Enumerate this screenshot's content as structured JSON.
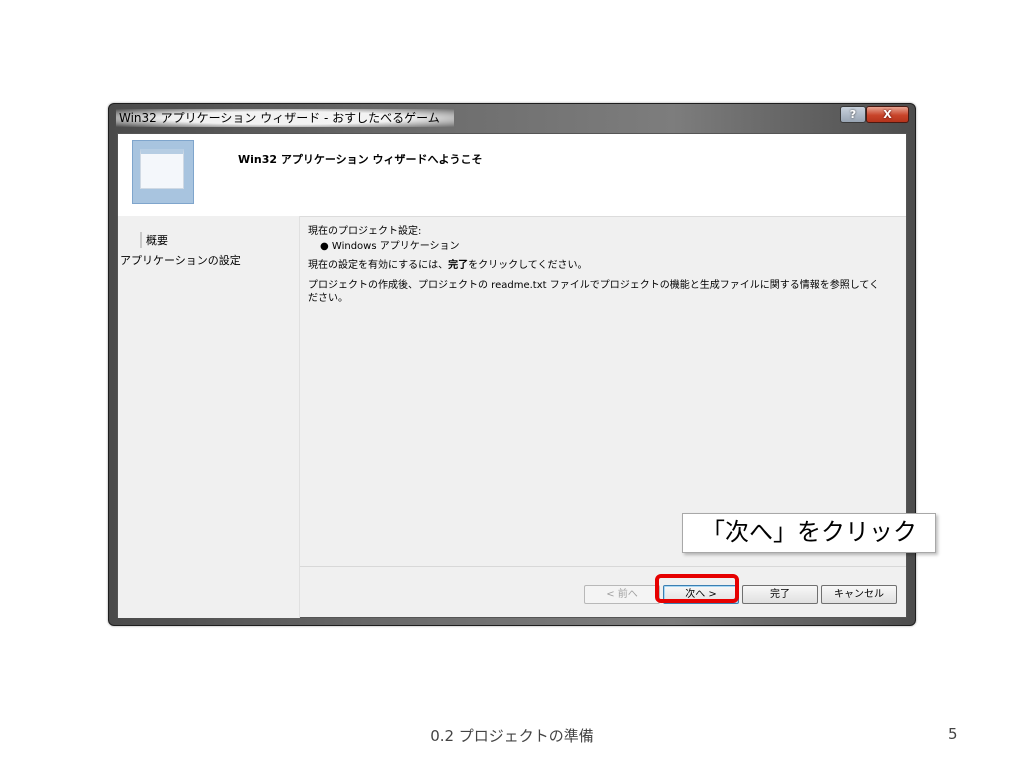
{
  "window": {
    "title": "Win32 アプリケーション ウィザード - おすしたべるゲーム",
    "help_button": "?",
    "close_button": "X"
  },
  "header": {
    "title": "Win32 アプリケーション ウィザードへようこそ"
  },
  "sidebar": {
    "items": [
      {
        "label": "概要"
      },
      {
        "label": "アプリケーションの設定"
      }
    ]
  },
  "content": {
    "current_settings_label": "現在のプロジェクト設定:",
    "bullet": "Windows アプリケーション",
    "accept_text_prefix": "現在の設定を有効にするには、",
    "accept_text_bold": "完了",
    "accept_text_suffix": "をクリックしてください。",
    "readme_text": "プロジェクトの作成後、プロジェクトの readme.txt ファイルでプロジェクトの機能と生成ファイルに関する情報を参照してください。"
  },
  "buttons": {
    "prev": "< 前へ",
    "next": "次へ >",
    "finish": "完了",
    "cancel": "キャンセル"
  },
  "annotation": {
    "callout": "「次へ」をクリック",
    "highlight_color": "#e60000"
  },
  "slide": {
    "footer": "0.2 プロジェクトの準備",
    "page_number": "5"
  }
}
